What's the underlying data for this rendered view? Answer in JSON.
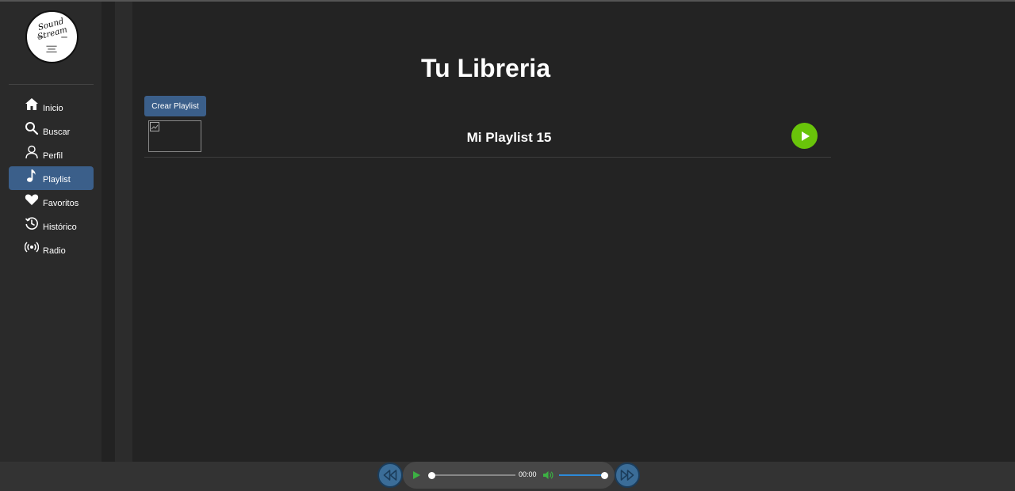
{
  "app": {
    "logo_text": "Sound Stream"
  },
  "sidebar": {
    "items": [
      {
        "label": "Inicio",
        "icon": "home-icon",
        "active": false
      },
      {
        "label": "Buscar",
        "icon": "search-icon",
        "active": false
      },
      {
        "label": "Perfil",
        "icon": "user-icon",
        "active": false
      },
      {
        "label": "Playlist",
        "icon": "music-note-icon",
        "active": true
      },
      {
        "label": "Favoritos",
        "icon": "heart-icon",
        "active": false
      },
      {
        "label": "Histórico",
        "icon": "history-icon",
        "active": false
      },
      {
        "label": "Radio",
        "icon": "radio-icon",
        "active": false
      }
    ]
  },
  "main": {
    "title": "Tu Libreria",
    "create_button_label": "Crear Playlist",
    "playlists": [
      {
        "name": "Mi Playlist 15"
      }
    ]
  },
  "player": {
    "time": "00:00",
    "progress": 0,
    "volume": 1.0
  },
  "colors": {
    "accent": "#3b5f8a",
    "play_green": "#69c40a",
    "volume_blue": "#2c8ad9",
    "background": "#232323",
    "sidebar": "#2a2a2a"
  }
}
